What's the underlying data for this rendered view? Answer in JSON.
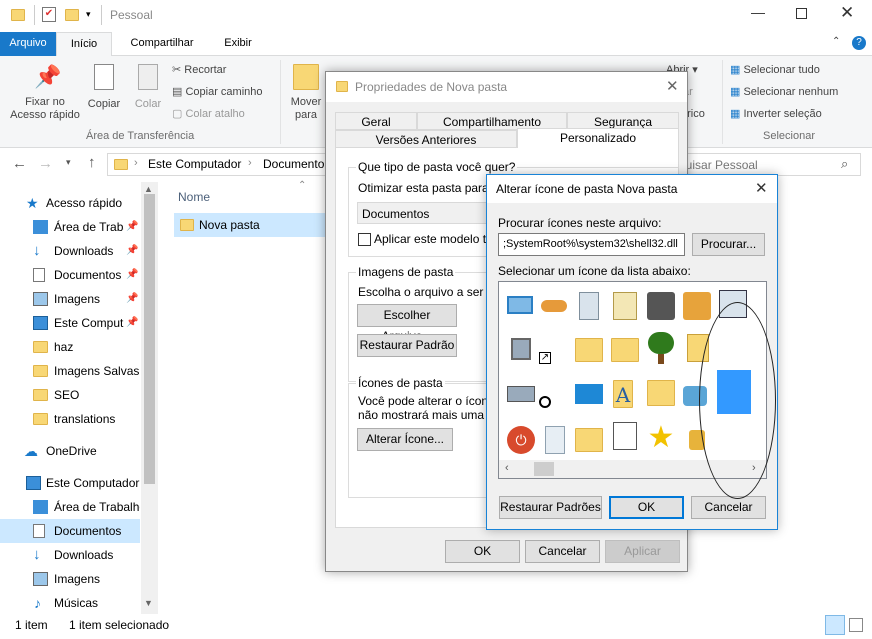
{
  "explorer": {
    "title": "Pessoal",
    "ribbon_tabs": [
      "Arquivo",
      "Início",
      "Compartilhar",
      "Exibir"
    ],
    "clipboard": {
      "pin_label": "Fixar no\nAcesso rápido",
      "copy_label": "Copiar",
      "paste_label": "Colar",
      "cut_label": "Recortar",
      "copy_path_label": "Copiar caminho",
      "paste_shortcut_label": "Colar atalho",
      "group_label": "Área de Transferência"
    },
    "organize": {
      "move_label": "Mover\npara"
    },
    "open": {
      "open_label": "Abrir",
      "history_label": "órico"
    },
    "select": {
      "select_all": "Selecionar tudo",
      "select_none": "Selecionar nenhum",
      "invert": "Inverter seleção",
      "group_label": "Selecionar"
    },
    "address": {
      "segments": [
        "Este Computador",
        "Documento"
      ]
    },
    "search_placeholder": "quisar Pessoal",
    "file_header": "Nome",
    "files": [
      {
        "name": "Nova pasta"
      }
    ],
    "nav": [
      {
        "label": "Acesso rápido",
        "icon": "star-icon",
        "pinned": false
      },
      {
        "label": "Área de Traba",
        "icon": "desktop-icon",
        "pinned": true
      },
      {
        "label": "Downloads",
        "icon": "download-icon",
        "pinned": true
      },
      {
        "label": "Documentos",
        "icon": "document-icon",
        "pinned": true
      },
      {
        "label": "Imagens",
        "icon": "image-icon",
        "pinned": true
      },
      {
        "label": "Este Comput",
        "icon": "computer-icon",
        "pinned": true
      },
      {
        "label": "haz",
        "icon": "folder-icon",
        "pinned": false
      },
      {
        "label": "Imagens Salvas",
        "icon": "folder-icon",
        "pinned": false
      },
      {
        "label": "SEO",
        "icon": "folder-icon",
        "pinned": false
      },
      {
        "label": "translations",
        "icon": "folder-icon",
        "pinned": false
      },
      {
        "label": "OneDrive",
        "icon": "cloud-icon",
        "pinned": false
      },
      {
        "label": "Este Computador",
        "icon": "computer-icon",
        "pinned": false
      },
      {
        "label": "Área de Trabalho",
        "icon": "desktop-icon",
        "pinned": false
      },
      {
        "label": "Documentos",
        "icon": "document-icon",
        "pinned": false
      },
      {
        "label": "Downloads",
        "icon": "download-icon",
        "pinned": false
      },
      {
        "label": "Imagens",
        "icon": "image-icon",
        "pinned": false
      },
      {
        "label": "Músicas",
        "icon": "music-icon",
        "pinned": false
      }
    ],
    "status": {
      "count": "1 item",
      "selected": "1 item selecionado"
    }
  },
  "properties": {
    "title": "Propriedades de Nova pasta",
    "tabs_row1": [
      "Geral",
      "Compartilhamento",
      "Segurança"
    ],
    "tabs_row2": [
      "Versões Anteriores",
      "Personalizado"
    ],
    "q_type": "Que tipo de pasta você quer?",
    "optimize_label": "Otimizar esta pasta para:",
    "optimize_value": "Documentos",
    "apply_template": "Aplicar este modelo tamb",
    "images_group": "Imagens de pasta",
    "choose_file_text": "Escolha o arquivo a ser exib",
    "choose_file_btn": "Escolher Arquivo...",
    "restore_default_btn": "Restaurar Padrão",
    "icons_group": "Ícones de pasta",
    "icons_text1": "Você pode alterar o ícone d",
    "icons_text2": "não mostrará mais uma visu",
    "change_icon_btn": "Alterar Ícone...",
    "ok": "OK",
    "cancel": "Cancelar",
    "apply": "Aplicar"
  },
  "change_icon": {
    "title": "Alterar ícone de pasta Nova pasta",
    "search_label": "Procurar ícones neste arquivo:",
    "file_path": ";SystemRoot%\\system32\\shell32.dll",
    "browse_btn": "Procurar...",
    "list_label": "Selecionar um ícone da lista abaixo:",
    "restore_btn": "Restaurar Padrões",
    "ok": "OK",
    "cancel": "Cancelar"
  },
  "colors": {
    "accent": "#1979ca",
    "selection": "#cce8ff",
    "selected_icon": "#3399ff"
  }
}
